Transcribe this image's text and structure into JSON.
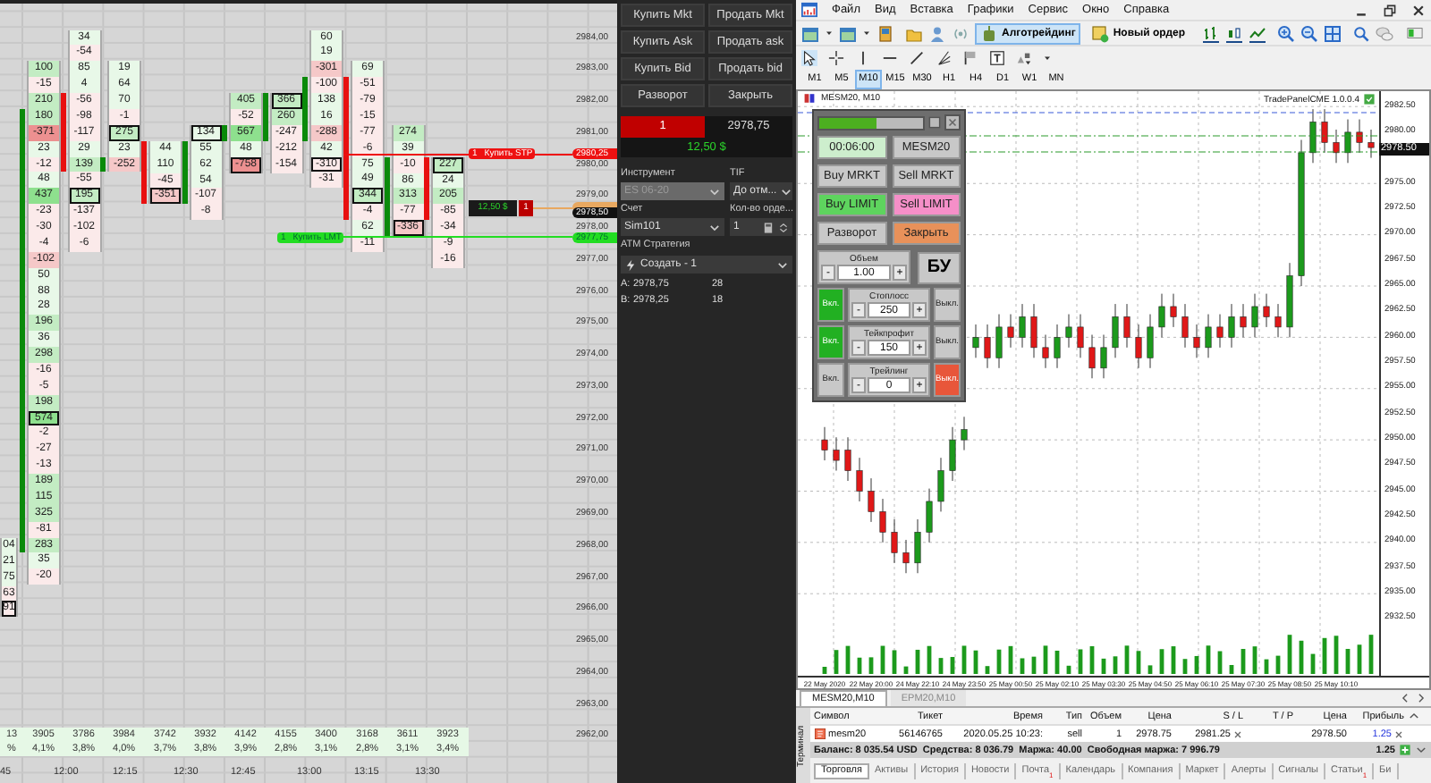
{
  "footprint": {
    "columns": [
      {
        "cells": [
          {
            "value": "04",
            "color": "#e8f8e8",
            "body": false,
            "outlined": false
          },
          {
            "value": "21",
            "color": "#e8f8e8",
            "body": false,
            "outlined": false
          },
          {
            "value": "75",
            "color": "#e8f8e8",
            "body": false,
            "outlined": false
          },
          {
            "value": "63",
            "color": "#fbeaea",
            "body": false,
            "outlined": false
          },
          {
            "value": "91",
            "color": "#fbeaea",
            "body": false,
            "outlined": true
          }
        ],
        "volume": "13",
        "percent": "%"
      },
      {
        "kind": "up",
        "cells": [
          {
            "value": "100",
            "color": "#c3ecc3",
            "body": false,
            "outlined": false
          },
          {
            "value": "-15",
            "color": "#fbeaea",
            "body": false,
            "outlined": false
          },
          {
            "value": "210",
            "color": "#c3ecc3",
            "body": false,
            "outlined": false
          },
          {
            "value": "180",
            "color": "#c3ecc3",
            "body": true,
            "outlined": false
          },
          {
            "value": "-371",
            "color": "#ec9090",
            "body": true,
            "outlined": false
          },
          {
            "value": "23",
            "color": "#e8f8e8",
            "body": true,
            "outlined": false
          },
          {
            "value": "-12",
            "color": "#fbeaea",
            "body": true,
            "outlined": false
          },
          {
            "value": "48",
            "color": "#e8f8e8",
            "body": true,
            "outlined": false
          },
          {
            "value": "437",
            "color": "#8ee08e",
            "body": true,
            "outlined": false
          },
          {
            "value": "-23",
            "color": "#fbeaea",
            "body": true,
            "outlined": false
          },
          {
            "value": "-30",
            "color": "#fbeaea",
            "body": true,
            "outlined": false
          },
          {
            "value": "-4",
            "color": "#fbeaea",
            "body": true,
            "outlined": false
          },
          {
            "value": "-102",
            "color": "#f5c8c8",
            "body": true,
            "outlined": false
          },
          {
            "value": "50",
            "color": "#e8f8e8",
            "body": true,
            "outlined": false
          },
          {
            "value": "88",
            "color": "#e8f8e8",
            "body": true,
            "outlined": false
          },
          {
            "value": "28",
            "color": "#e8f8e8",
            "body": true,
            "outlined": false
          },
          {
            "value": "196",
            "color": "#c3ecc3",
            "body": true,
            "outlined": false
          },
          {
            "value": "36",
            "color": "#e8f8e8",
            "body": true,
            "outlined": false
          },
          {
            "value": "298",
            "color": "#c3ecc3",
            "body": true,
            "outlined": false
          },
          {
            "value": "-16",
            "color": "#fbeaea",
            "body": true,
            "outlined": false
          },
          {
            "value": "-5",
            "color": "#fbeaea",
            "body": true,
            "outlined": false
          },
          {
            "value": "198",
            "color": "#c3ecc3",
            "body": true,
            "outlined": false
          },
          {
            "value": "574",
            "color": "#8ee08e",
            "body": true,
            "outlined": true
          },
          {
            "value": "-2",
            "color": "#fbeaea",
            "body": true,
            "outlined": false
          },
          {
            "value": "-27",
            "color": "#fbeaea",
            "body": true,
            "outlined": false
          },
          {
            "value": "-13",
            "color": "#fbeaea",
            "body": true,
            "outlined": false
          },
          {
            "value": "189",
            "color": "#c3ecc3",
            "body": true,
            "outlined": false
          },
          {
            "value": "115",
            "color": "#c3ecc3",
            "body": true,
            "outlined": false
          },
          {
            "value": "325",
            "color": "#c3ecc3",
            "body": true,
            "outlined": false
          },
          {
            "value": "-81",
            "color": "#fbeaea",
            "body": true,
            "outlined": false
          },
          {
            "value": "283",
            "color": "#c3ecc3",
            "body": true,
            "outlined": false
          },
          {
            "value": "35",
            "color": "#e8f8e8",
            "body": false,
            "outlined": false
          },
          {
            "value": "-20",
            "color": "#fbeaea",
            "body": false,
            "outlined": false
          }
        ],
        "volume": "3905",
        "percent": "4,1%"
      },
      {
        "kind": "down",
        "cells": [
          {
            "value": "34",
            "color": "#e8f8e8",
            "body": false,
            "outlined": false
          },
          {
            "value": "-54",
            "color": "#fbeaea",
            "body": false,
            "outlined": false
          },
          {
            "value": "85",
            "color": "#e8f8e8",
            "body": false,
            "outlined": false
          },
          {
            "value": "4",
            "color": "#e8f8e8",
            "body": false,
            "outlined": false
          },
          {
            "value": "-56",
            "color": "#fbeaea",
            "body": true,
            "outlined": false
          },
          {
            "value": "-98",
            "color": "#fbeaea",
            "body": true,
            "outlined": false
          },
          {
            "value": "-117",
            "color": "#fbeaea",
            "body": true,
            "outlined": false
          },
          {
            "value": "29",
            "color": "#e8f8e8",
            "body": true,
            "outlined": false
          },
          {
            "value": "139",
            "color": "#c3ecc3",
            "body": true,
            "outlined": false
          },
          {
            "value": "-55",
            "color": "#fbeaea",
            "body": false,
            "outlined": false
          },
          {
            "value": "195",
            "color": "#c3ecc3",
            "body": false,
            "outlined": true
          },
          {
            "value": "-137",
            "color": "#fbeaea",
            "body": false,
            "outlined": false
          },
          {
            "value": "-102",
            "color": "#fbeaea",
            "body": false,
            "outlined": false
          },
          {
            "value": "-6",
            "color": "#fbeaea",
            "body": false,
            "outlined": false
          }
        ],
        "volume": "3786",
        "percent": "3,8%"
      },
      {
        "kind": "up",
        "cells": [
          {
            "value": "19",
            "color": "#e8f8e8",
            "body": false,
            "outlined": false
          },
          {
            "value": "64",
            "color": "#e8f8e8",
            "body": false,
            "outlined": false
          },
          {
            "value": "70",
            "color": "#e8f8e8",
            "body": false,
            "outlined": false
          },
          {
            "value": "-1",
            "color": "#fbeaea",
            "body": false,
            "outlined": false
          },
          {
            "value": "275",
            "color": "#c3ecc3",
            "body": false,
            "outlined": true
          },
          {
            "value": "23",
            "color": "#e8f8e8",
            "body": false,
            "outlined": false
          },
          {
            "value": "-252",
            "color": "#f5c8c8",
            "body": true,
            "outlined": false
          }
        ],
        "volume": "3984",
        "percent": "4,0%"
      },
      {
        "kind": "down",
        "cells": [
          {
            "value": "44",
            "color": "#e8f8e8",
            "body": true,
            "outlined": false
          },
          {
            "value": "110",
            "color": "#e8f8e8",
            "body": true,
            "outlined": false
          },
          {
            "value": "-45",
            "color": "#fbeaea",
            "body": true,
            "outlined": false
          },
          {
            "value": "-351",
            "color": "#f5c8c8",
            "body": true,
            "outlined": true
          }
        ],
        "volume": "3742",
        "percent": "3,7%"
      },
      {
        "kind": "up",
        "cells": [
          {
            "value": "134",
            "color": "#e8f8e8",
            "body": false,
            "outlined": true
          },
          {
            "value": "55",
            "color": "#e8f8e8",
            "body": true,
            "outlined": false
          },
          {
            "value": "62",
            "color": "#e8f8e8",
            "body": true,
            "outlined": false
          },
          {
            "value": "54",
            "color": "#e8f8e8",
            "body": true,
            "outlined": false
          },
          {
            "value": "-107",
            "color": "#fbeaea",
            "body": true,
            "outlined": false
          },
          {
            "value": "-8",
            "color": "#fbeaea",
            "body": false,
            "outlined": false
          }
        ],
        "volume": "3932",
        "percent": "3,8%"
      },
      {
        "kind": "up",
        "cells": [
          {
            "value": "405",
            "color": "#c3ecc3",
            "body": false,
            "outlined": false
          },
          {
            "value": "-52",
            "color": "#fbeaea",
            "body": false,
            "outlined": false
          },
          {
            "value": "567",
            "color": "#8ee08e",
            "body": true,
            "outlined": false
          },
          {
            "value": "48",
            "color": "#e8f8e8",
            "body": false,
            "outlined": false
          },
          {
            "value": "-758",
            "color": "#ec9090",
            "body": false,
            "outlined": true
          }
        ],
        "volume": "4142",
        "percent": "3,9%"
      },
      {
        "kind": "up",
        "cells": [
          {
            "value": "366",
            "color": "#c3ecc3",
            "body": true,
            "outlined": true
          },
          {
            "value": "260",
            "color": "#c3ecc3",
            "body": true,
            "outlined": false
          },
          {
            "value": "-247",
            "color": "#fbeaea",
            "body": true,
            "outlined": false
          },
          {
            "value": "-212",
            "color": "#fbeaea",
            "body": false,
            "outlined": false
          },
          {
            "value": "-154",
            "color": "#fbeaea",
            "body": false,
            "outlined": false
          }
        ],
        "volume": "4155",
        "percent": "2,8%"
      },
      {
        "kind": "up",
        "cells": [
          {
            "value": "60",
            "color": "#e8f8e8",
            "body": false,
            "outlined": false
          },
          {
            "value": "19",
            "color": "#e8f8e8",
            "body": false,
            "outlined": false
          },
          {
            "value": "-301",
            "color": "#f5c8c8",
            "body": false,
            "outlined": false
          },
          {
            "value": "-100",
            "color": "#fbeaea",
            "body": true,
            "outlined": false
          },
          {
            "value": "138",
            "color": "#e8f8e8",
            "body": true,
            "outlined": false
          },
          {
            "value": "16",
            "color": "#e8f8e8",
            "body": true,
            "outlined": false
          },
          {
            "value": "-288",
            "color": "#f5c8c8",
            "body": true,
            "outlined": false
          },
          {
            "value": "42",
            "color": "#e8f8e8",
            "body": false,
            "outlined": false
          },
          {
            "value": "-310",
            "color": "#fbeaea",
            "body": false,
            "outlined": true
          },
          {
            "value": "-31",
            "color": "#fbeaea",
            "body": false,
            "outlined": false
          }
        ],
        "volume": "3400",
        "percent": "3,1%"
      },
      {
        "kind": "down",
        "cells": [
          {
            "value": "69",
            "color": "#e8f8e8",
            "body": false,
            "outlined": false
          },
          {
            "value": "-51",
            "color": "#fbeaea",
            "body": true,
            "outlined": false
          },
          {
            "value": "-79",
            "color": "#fbeaea",
            "body": true,
            "outlined": false
          },
          {
            "value": "-15",
            "color": "#fbeaea",
            "body": true,
            "outlined": false
          },
          {
            "value": "-77",
            "color": "#fbeaea",
            "body": true,
            "outlined": false
          },
          {
            "value": "-6",
            "color": "#fbeaea",
            "body": true,
            "outlined": false
          },
          {
            "value": "75",
            "color": "#e8f8e8",
            "body": true,
            "outlined": false
          },
          {
            "value": "49",
            "color": "#e8f8e8",
            "body": true,
            "outlined": false
          },
          {
            "value": "344",
            "color": "#c3ecc3",
            "body": true,
            "outlined": true
          },
          {
            "value": "-4",
            "color": "#fbeaea",
            "body": true,
            "outlined": false
          },
          {
            "value": "62",
            "color": "#e8f8e8",
            "body": false,
            "outlined": false
          },
          {
            "value": "-11",
            "color": "#fbeaea",
            "body": false,
            "outlined": false
          }
        ],
        "volume": "3168",
        "percent": "2,8%"
      },
      {
        "kind": "up",
        "cells": [
          {
            "value": "274",
            "color": "#c3ecc3",
            "body": false,
            "outlined": false
          },
          {
            "value": "39",
            "color": "#e8f8e8",
            "body": false,
            "outlined": false
          },
          {
            "value": "-10",
            "color": "#fbeaea",
            "body": true,
            "outlined": false
          },
          {
            "value": "86",
            "color": "#e8f8e8",
            "body": true,
            "outlined": false
          },
          {
            "value": "313",
            "color": "#c3ecc3",
            "body": true,
            "outlined": false
          },
          {
            "value": "-77",
            "color": "#fbeaea",
            "body": true,
            "outlined": false
          },
          {
            "value": "-336",
            "color": "#f5c8c8",
            "body": true,
            "outlined": true
          }
        ],
        "volume": "3611",
        "percent": "3,1%"
      },
      {
        "kind": "down",
        "cells": [
          {
            "value": "227",
            "color": "#c3ecc3",
            "body": true,
            "outlined": true
          },
          {
            "value": "24",
            "color": "#e8f8e8",
            "body": true,
            "outlined": false
          },
          {
            "value": "205",
            "color": "#c3ecc3",
            "body": true,
            "outlined": false
          },
          {
            "value": "-85",
            "color": "#fbeaea",
            "body": true,
            "outlined": false
          },
          {
            "value": "-34",
            "color": "#fbeaea",
            "body": false,
            "outlined": false
          },
          {
            "value": "-9",
            "color": "#fbeaea",
            "body": false,
            "outlined": false
          },
          {
            "value": "-16",
            "color": "#fbeaea",
            "body": false,
            "outlined": false
          }
        ],
        "volume": "3923",
        "percent": "3,4%"
      }
    ],
    "price_axis": [
      "2984,00",
      "2983,00",
      "2982,00",
      "2981,00",
      "2980,00",
      "2979,00",
      "2978,00",
      "2977,00",
      "2976,00",
      "2975,00",
      "2974,00",
      "2973,00",
      "2972,00",
      "2971,00",
      "2970,00",
      "2969,00",
      "2968,00",
      "2967,00",
      "2966,00",
      "2965,00",
      "2964,00",
      "2963,00",
      "2962,00"
    ],
    "time_axis": [
      "45",
      "12:00",
      "12:15",
      "12:30",
      "12:45",
      "13:00",
      "13:15",
      "13:30"
    ],
    "markers": [
      {
        "kind": "stop",
        "quantity": "1",
        "label": "Купить STP",
        "price": "2980,25"
      },
      {
        "kind": "position",
        "quantity": "1",
        "pnl": "12,50 $"
      },
      {
        "kind": "last",
        "price": "2978,50"
      },
      {
        "kind": "limit",
        "quantity": "1",
        "label": "Купить LMT",
        "price": "2977,75"
      }
    ]
  },
  "order_entry": {
    "buttons": [
      "Купить Mkt",
      "Продать Mkt",
      "Купить Ask",
      "Продать ask",
      "Купить Bid",
      "Продать bid",
      "Разворот",
      "Закрыть"
    ],
    "position": {
      "quantity": "1",
      "price": "2978,75",
      "pnl": "12,50 $"
    },
    "fields": [
      {
        "label": "Инструмент",
        "value": "ES 06-20",
        "kind": "select",
        "disabled": true
      },
      {
        "label": "TIF",
        "value": "До отм...",
        "kind": "select",
        "disabled": false
      },
      {
        "label": "Счет",
        "value": "Sim101",
        "kind": "select",
        "disabled": false
      },
      {
        "label": "Кол-во орде...",
        "value": "1",
        "kind": "spinner",
        "disabled": false
      }
    ],
    "atm": {
      "label": "ATM Стратегия",
      "value": "Создать - 1"
    },
    "quotes": [
      {
        "side": "A:",
        "price": "2978,75",
        "size": "28"
      },
      {
        "side": "B:",
        "price": "2978,25",
        "size": "18"
      }
    ]
  },
  "terminal_app": {
    "menu": [
      "Файл",
      "Вид",
      "Вставка",
      "Графики",
      "Сервис",
      "Окно",
      "Справка"
    ],
    "toolbar": [
      {
        "label": "Алготрейдинг",
        "pressed": true
      },
      {
        "label": "Новый ордер",
        "pressed": false
      }
    ],
    "timeframes": [
      {
        "label": "M1",
        "selected": false
      },
      {
        "label": "M5",
        "selected": false
      },
      {
        "label": "M10",
        "selected": true
      },
      {
        "label": "M15",
        "selected": false
      },
      {
        "label": "M30",
        "selected": false
      },
      {
        "label": "H1",
        "selected": false
      },
      {
        "label": "H4",
        "selected": false
      },
      {
        "label": "D1",
        "selected": false
      },
      {
        "label": "W1",
        "selected": false
      },
      {
        "label": "MN",
        "selected": false
      }
    ],
    "chart": {
      "title": "MESM20, M10",
      "expert": "TradePanelCME 1.0.0.4",
      "current_price": "2978.50",
      "chart_data": {
        "type": "candlestick",
        "categories": [
          "22 May 2020",
          null,
          null,
          null,
          "22 May 20:00",
          null,
          null,
          null,
          "24 May 22:10",
          null,
          null,
          null,
          "24 May 23:50",
          null,
          null,
          null,
          "25 May 00:50",
          null,
          null,
          null,
          "25 May 02:10",
          null,
          null,
          null,
          "25 May 03:30",
          null,
          null,
          null,
          "25 May 04:50",
          null,
          null,
          null,
          "25 May 06:10",
          null,
          null,
          null,
          "25 May 07:30",
          null,
          null,
          null,
          "25 May 08:50",
          null,
          null,
          null,
          "25 May 10:10",
          null,
          null,
          null
        ],
        "ohlc": [
          [
            2950,
            2951.25,
            2948,
            2949
          ],
          [
            2949,
            2950.25,
            2947,
            2948
          ],
          [
            2949,
            2950.25,
            2946,
            2947
          ],
          [
            2947,
            2948.25,
            2944,
            2945
          ],
          [
            2945,
            2946.25,
            2942,
            2943
          ],
          [
            2943,
            2944.25,
            2940,
            2941
          ],
          [
            2941,
            2942.25,
            2938,
            2939
          ],
          [
            2939,
            2940.25,
            2937,
            2938
          ],
          [
            2938,
            2942.25,
            2937,
            2941
          ],
          [
            2941,
            2945.25,
            2940,
            2944
          ],
          [
            2944,
            2948.25,
            2943,
            2947
          ],
          [
            2947,
            2951.25,
            2946,
            2950
          ],
          [
            2950,
            2952.25,
            2949,
            2951
          ],
          [
            2959,
            2961.25,
            2958,
            2960
          ],
          [
            2960,
            2961.25,
            2957,
            2958
          ],
          [
            2958,
            2962.25,
            2957,
            2961
          ],
          [
            2961,
            2962.25,
            2959,
            2960
          ],
          [
            2960,
            2963.25,
            2959,
            2962
          ],
          [
            2962,
            2963.25,
            2958,
            2959
          ],
          [
            2959,
            2960.25,
            2957,
            2958
          ],
          [
            2958,
            2961.25,
            2957,
            2960
          ],
          [
            2960,
            2962.25,
            2959,
            2961
          ],
          [
            2961,
            2962.25,
            2958,
            2959
          ],
          [
            2959,
            2960.25,
            2956,
            2957
          ],
          [
            2957,
            2960.25,
            2956,
            2959
          ],
          [
            2959,
            2963.25,
            2958,
            2962
          ],
          [
            2962,
            2963.25,
            2959,
            2960
          ],
          [
            2960,
            2961.25,
            2957,
            2958
          ],
          [
            2958,
            2962.25,
            2957,
            2961
          ],
          [
            2961,
            2964.25,
            2960,
            2963
          ],
          [
            2963,
            2964.25,
            2961,
            2962
          ],
          [
            2962,
            2963.25,
            2959,
            2960
          ],
          [
            2960,
            2961.25,
            2958,
            2959
          ],
          [
            2959,
            2962.25,
            2958,
            2961
          ],
          [
            2961,
            2962.25,
            2959,
            2960
          ],
          [
            2960,
            2963.25,
            2959,
            2962
          ],
          [
            2962,
            2963.25,
            2960,
            2961
          ],
          [
            2961,
            2964.25,
            2960,
            2963
          ],
          [
            2963,
            2964.25,
            2961,
            2962
          ],
          [
            2962,
            2963.25,
            2960,
            2961
          ],
          [
            2961,
            2967.25,
            2960,
            2966
          ],
          [
            2966,
            2979.25,
            2965,
            2978
          ],
          [
            2978,
            2982.25,
            2977,
            2981
          ],
          [
            2981,
            2982.25,
            2978,
            2979
          ],
          [
            2979,
            2980.25,
            2977,
            2978
          ],
          [
            2978,
            2981.25,
            2977,
            2980
          ],
          [
            2980,
            2981.25,
            2978,
            2979
          ],
          [
            2979,
            2980.25,
            2977.5,
            2978.5
          ]
        ],
        "ylim": [
          2927,
          2984
        ],
        "grid": true,
        "yticks": [
          {
            "value": 2982.5,
            "label": "2982.50"
          },
          {
            "value": 2980,
            "label": "2980.00"
          },
          {
            "value": 2975,
            "label": "2975.00"
          },
          {
            "value": 2972.5,
            "label": "2972.50"
          },
          {
            "value": 2970,
            "label": "2970.00"
          },
          {
            "value": 2967.5,
            "label": "2967.50"
          },
          {
            "value": 2965,
            "label": "2965.00"
          },
          {
            "value": 2962.5,
            "label": "2962.50"
          },
          {
            "value": 2960,
            "label": "2960.00"
          },
          {
            "value": 2957.5,
            "label": "2957.50"
          },
          {
            "value": 2955,
            "label": "2955.00"
          },
          {
            "value": 2952.5,
            "label": "2952.50"
          },
          {
            "value": 2950,
            "label": "2950.00"
          },
          {
            "value": 2947.5,
            "label": "2947.50"
          },
          {
            "value": 2945,
            "label": "2945.00"
          },
          {
            "value": 2942.5,
            "label": "2942.50"
          },
          {
            "value": 2940,
            "label": "2940.00"
          },
          {
            "value": 2937.5,
            "label": "2937.50"
          },
          {
            "value": 2935,
            "label": "2935.00"
          },
          {
            "value": 2932.5,
            "label": "2932.50"
          }
        ]
      }
    },
    "trade_panel": {
      "level": 0.55,
      "buttons": [
        {
          "label": "00:06:00",
          "color": "#cdeecd"
        },
        {
          "label": "MESM20",
          "color": "#c8c8c8"
        },
        {
          "label": "Buy MRKT",
          "color": "#c8c8c8"
        },
        {
          "label": "Sell MRKT",
          "color": "#c8c8c8"
        },
        {
          "label": "Buy LIMIT",
          "color": "#5ed45e"
        },
        {
          "label": "Sell LIMIT",
          "color": "#f58fc8"
        },
        {
          "label": "Разворот",
          "color": "#c8c8c8"
        },
        {
          "label": "Закрыть",
          "color": "#e8915a"
        }
      ],
      "volume": {
        "label": "Объем",
        "minus": "-",
        "value": "1.00",
        "plus": "+"
      },
      "breakeven": "БУ",
      "settings": [
        {
          "label": "Стоплосс",
          "value": "250",
          "minus": "-",
          "plus": "+",
          "on": true,
          "on_label": "Вкл.",
          "off_label": "Выкл."
        },
        {
          "label": "Тейкпрофит",
          "value": "150",
          "minus": "-",
          "plus": "+",
          "on": true,
          "on_label": "Вкл.",
          "off_label": "Выкл."
        },
        {
          "label": "Трейлинг",
          "value": "0",
          "minus": "-",
          "plus": "+",
          "on": false,
          "on_label": "Вкл.",
          "off_label": "Выкл."
        }
      ]
    },
    "chart_tabs": [
      {
        "label": "MESM20,M10",
        "selected": true
      },
      {
        "label": "EPM20,M10",
        "selected": false
      }
    ],
    "caption": "Терминал",
    "positions": {
      "columns": [
        "Символ",
        "Тикет",
        "Время",
        "Тип",
        "Объем",
        "Цена",
        "S / L",
        "T / P",
        "Цена",
        "Прибыль"
      ],
      "rows": [
        {
          "symbol": "mesm20",
          "ticket": "56146765",
          "time": "2020.05.25 10:23:",
          "type": "sell",
          "volume": "1",
          "price": "2978.75",
          "sl": "2981.25",
          "current": "2978.50",
          "profit": "1.25"
        }
      ]
    },
    "summary": {
      "text": "Баланс: 8 035.54 USD  Средства: 8 036.79  Маржа: 40.00  Свободная маржа: 7 996.79",
      "profit": "1.25"
    },
    "tabs": [
      {
        "label": "Торговля",
        "selected": true
      },
      {
        "label": "Активы",
        "selected": false
      },
      {
        "label": "История",
        "selected": false
      },
      {
        "label": "Новости",
        "selected": false
      },
      {
        "label": "Почта",
        "selected": false,
        "badge": "1"
      },
      {
        "label": "Календарь",
        "selected": false
      },
      {
        "label": "Компания",
        "selected": false
      },
      {
        "label": "Маркет",
        "selected": false
      },
      {
        "label": "Алерты",
        "selected": false
      },
      {
        "label": "Сигналы",
        "selected": false
      },
      {
        "label": "Статьи",
        "selected": false,
        "badge": "1"
      },
      {
        "label": "Би",
        "selected": false
      }
    ]
  }
}
